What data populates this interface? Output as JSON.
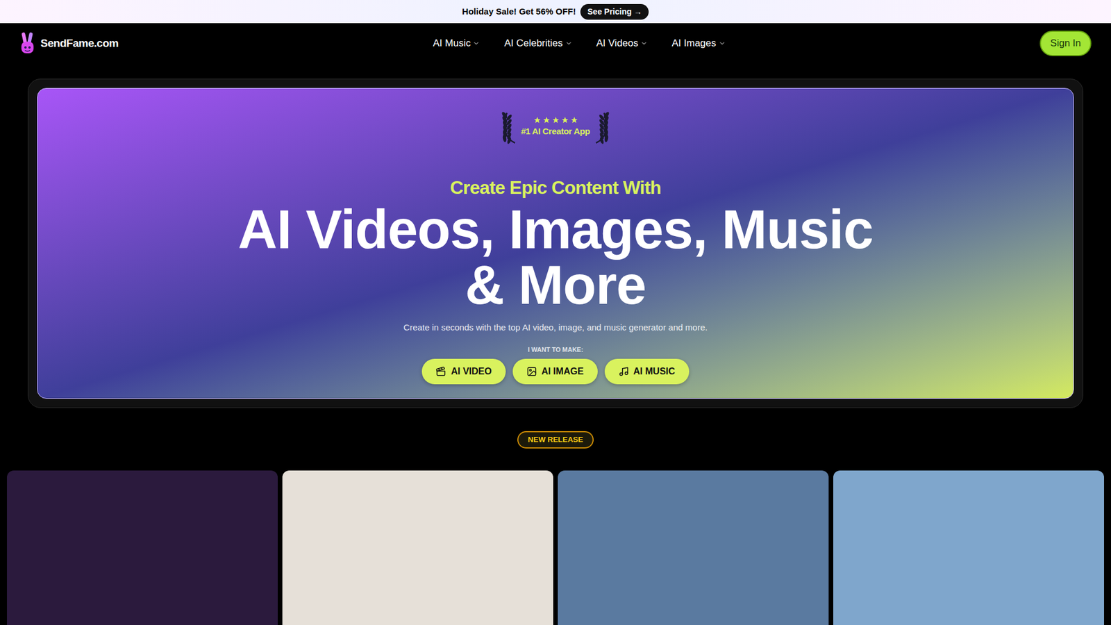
{
  "banner": {
    "text": "Holiday Sale! Get 56% OFF!",
    "button": "See Pricing →"
  },
  "header": {
    "logo": "SendFame.com",
    "nav": [
      {
        "label": "AI Music"
      },
      {
        "label": "AI Celebrities"
      },
      {
        "label": "AI Videos"
      },
      {
        "label": "AI Images"
      }
    ],
    "sign_in": "Sign In"
  },
  "hero": {
    "badge": {
      "stars": 5,
      "label": "#1 AI Creator App"
    },
    "eyebrow": "Create Epic Content With",
    "title_lines": [
      "AI Videos, Images, Music",
      "& More"
    ],
    "description": "Create in seconds with the top AI video, image, and music generator and more.",
    "prompt": "I WANT TO MAKE:",
    "buttons": [
      {
        "label": "AI VIDEO",
        "kind": "video"
      },
      {
        "label": "AI IMAGE",
        "kind": "image"
      },
      {
        "label": "AI MUSIC",
        "kind": "music"
      }
    ]
  },
  "new_release": {
    "badge": "NEW RELEASE",
    "cards": [
      {
        "color": "#2b1a3d"
      },
      {
        "color": "#e6e0d8"
      },
      {
        "color": "#5a7aa0"
      },
      {
        "color": "#7fa6cc"
      }
    ]
  }
}
